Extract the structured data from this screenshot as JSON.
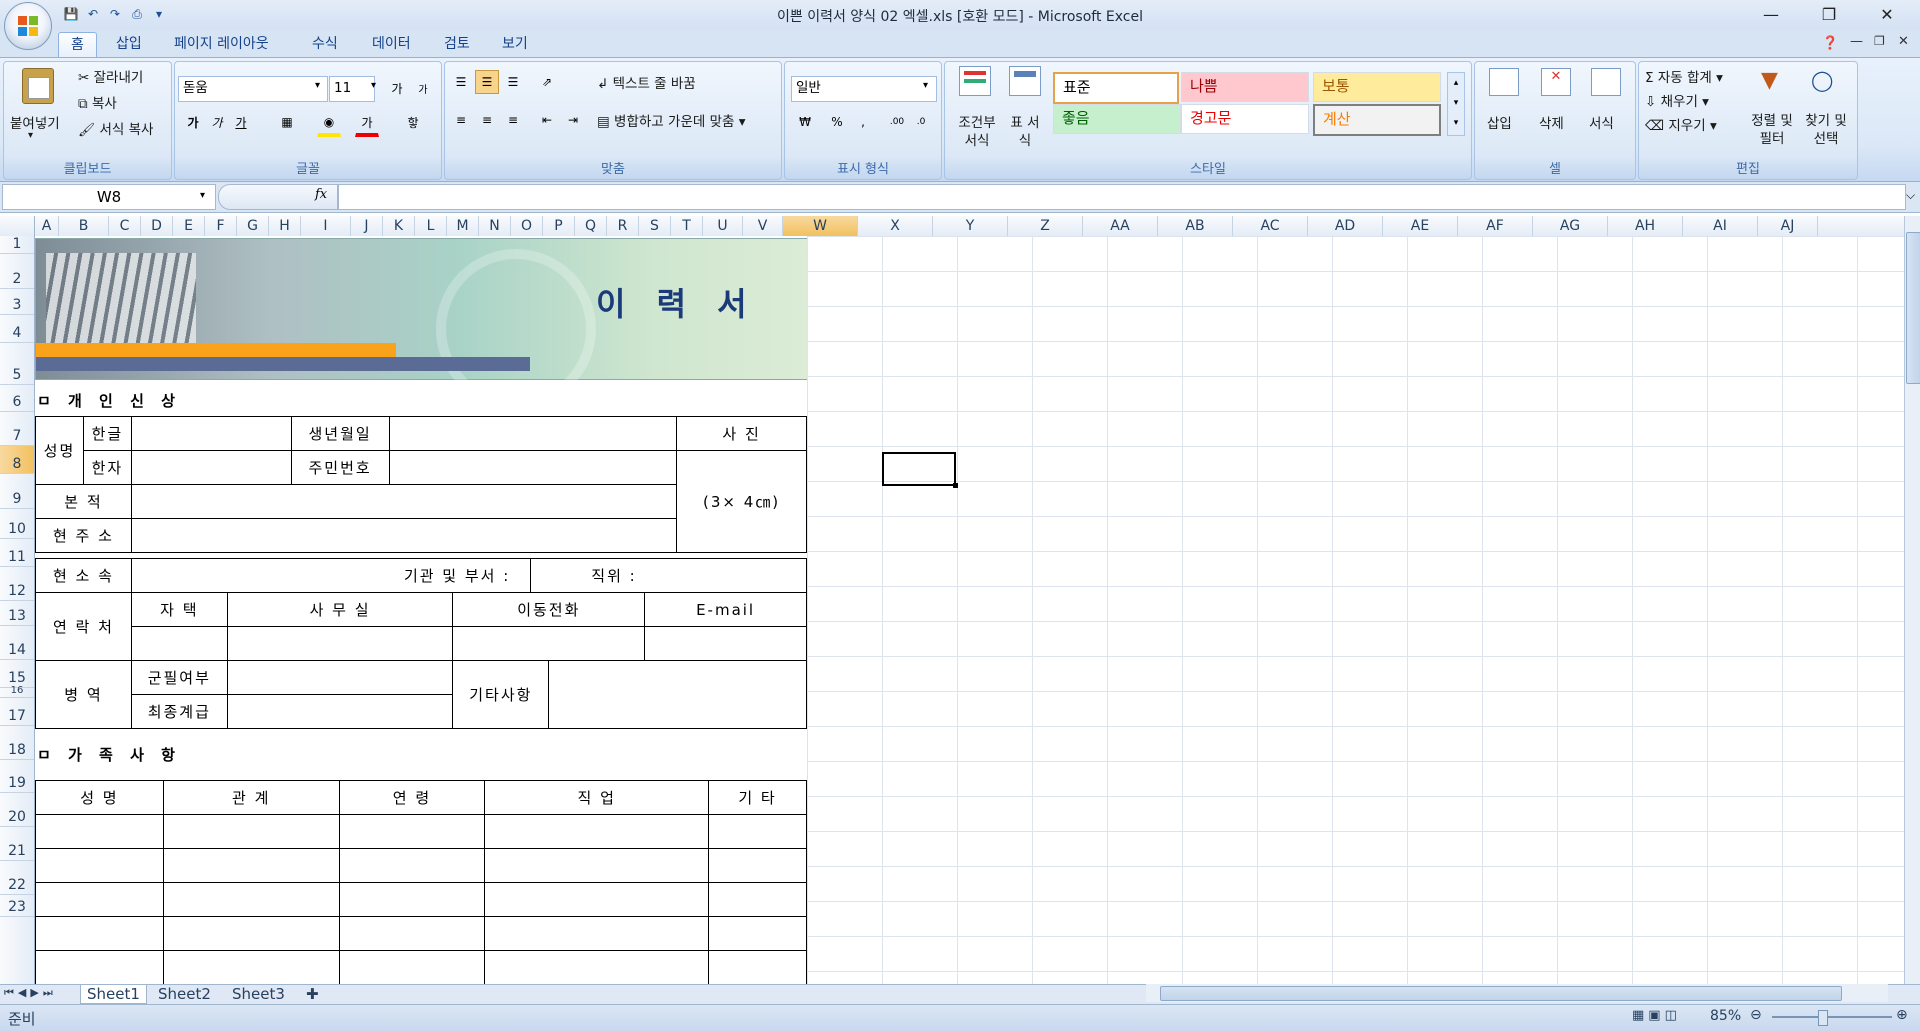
{
  "window": {
    "title": "이쁜 이력서 양식 02 엑셀.xls  [호환 모드] - Microsoft Excel"
  },
  "tabs": [
    "홈",
    "삽입",
    "페이지 레이아웃",
    "수식",
    "데이터",
    "검토",
    "보기"
  ],
  "ribbon": {
    "clipboard": {
      "paste": "붙여넣기",
      "cut": "잘라내기",
      "copy": "복사",
      "format_painter": "서식 복사",
      "label": "클립보드"
    },
    "font": {
      "name": "돋움",
      "size": "11",
      "label": "글꼴"
    },
    "alignment": {
      "wrap": "텍스트 줄 바꿈",
      "merge": "병합하고 가운데 맞춤",
      "label": "맞춤"
    },
    "number": {
      "format": "일반",
      "label": "표시 형식"
    },
    "styles": {
      "conditional": "조건부 서식",
      "table": "표 서식",
      "cells": [
        "표준",
        "나쁨",
        "보통",
        "좋음",
        "경고문",
        "계산"
      ],
      "label": "스타일"
    },
    "cells_group": {
      "insert": "삽입",
      "delete": "삭제",
      "format": "서식",
      "label": "셀"
    },
    "editing": {
      "autosum": "자동 합계",
      "fill": "채우기",
      "clear": "지우기",
      "sort": "정렬 및 필터",
      "find": "찾기 및 선택",
      "label": "편집"
    }
  },
  "formula_bar": {
    "name_box": "W8",
    "fx": "fx",
    "value": ""
  },
  "columns": [
    "A",
    "B",
    "C",
    "D",
    "E",
    "F",
    "G",
    "H",
    "I",
    "J",
    "K",
    "L",
    "M",
    "N",
    "O",
    "P",
    "Q",
    "R",
    "S",
    "T",
    "U",
    "V",
    "W",
    "X",
    "Y",
    "Z",
    "AA",
    "AB",
    "AC",
    "AD",
    "AE",
    "AF",
    "AG",
    "AH",
    "AI",
    "AJ"
  ],
  "rows": [
    "1",
    "2",
    "3",
    "4",
    "5",
    "6",
    "7",
    "8",
    "9",
    "10",
    "11",
    "12",
    "13",
    "14",
    "15",
    "16",
    "17",
    "18",
    "19",
    "20",
    "21",
    "22",
    "23"
  ],
  "resume": {
    "banner_title": "이 력 서",
    "section_personal": "ㅁ 개 인 신 상",
    "name": "성명",
    "hangul": "한글",
    "hanja": "한자",
    "birth": "생년월일",
    "idnum": "주민번호",
    "photo": "사    진",
    "photo_size": "(3× 4㎝)",
    "origin": "본      적",
    "address": "현 주 소",
    "affiliation": "현 소 속",
    "dept": "기관 및 부서 :",
    "position": "직위 :",
    "contact": "연 락 처",
    "home": "자    택",
    "office": "사   무   실",
    "mobile": "이동전화",
    "email": "E-mail",
    "military": "병     역",
    "mil_status": "군필여부",
    "rank": "최종계급",
    "etc_note": "기타사항",
    "section_family": "ㅁ 가 족 사 항",
    "fam_name": "성      명",
    "fam_rel": "관      계",
    "fam_age": "연      령",
    "fam_job": "직      업",
    "fam_etc": "기    타"
  },
  "sheets": [
    "Sheet1",
    "Sheet2",
    "Sheet3"
  ],
  "status": {
    "text": "준비",
    "zoom": "85%"
  }
}
